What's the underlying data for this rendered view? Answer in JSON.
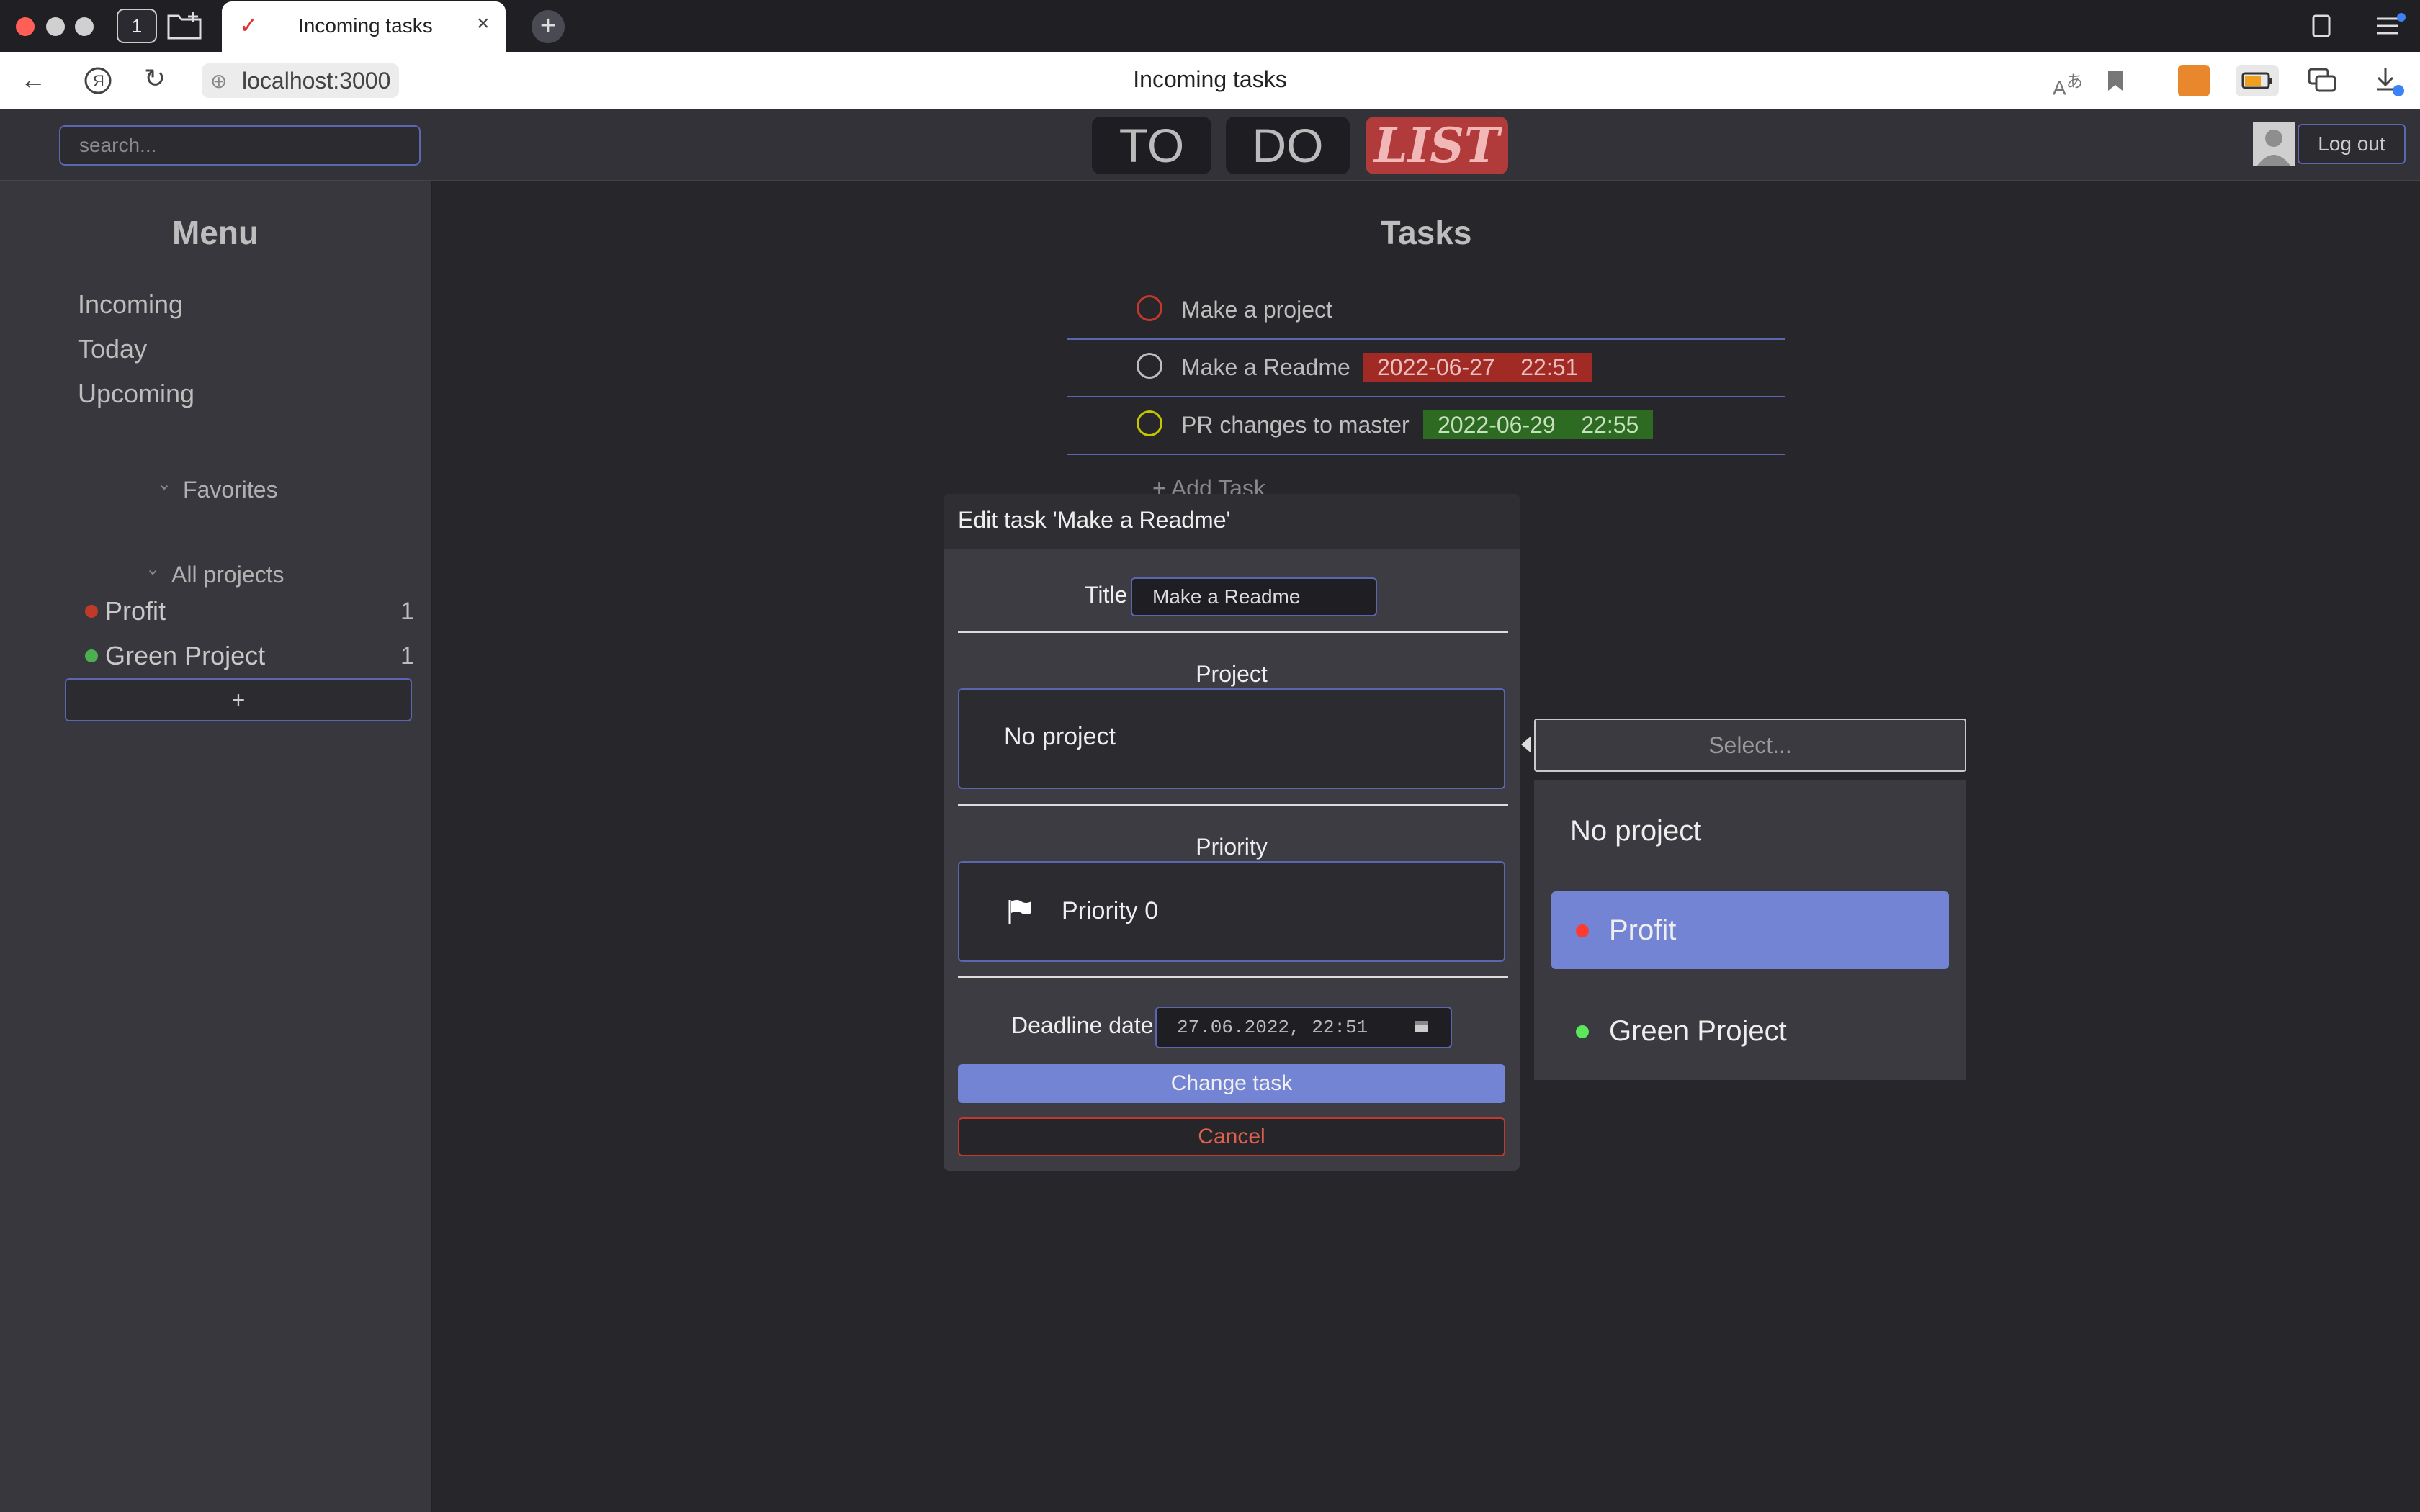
{
  "browser": {
    "tab_title": "Incoming tasks",
    "tab_close": "×",
    "tab_count": "1",
    "new_tab": "+",
    "url": "localhost:3000",
    "page_title": "Incoming tasks"
  },
  "header": {
    "search_placeholder": "search...",
    "logo": [
      "TO",
      "DO",
      "LIST"
    ],
    "logout_label": "Log out"
  },
  "sidebar": {
    "title": "Menu",
    "items": [
      {
        "label": "Incoming"
      },
      {
        "label": "Today"
      },
      {
        "label": "Upcoming"
      }
    ],
    "favorites_label": "Favorites",
    "projects_label": "All projects",
    "projects": [
      {
        "name": "Profit",
        "count": "1",
        "color": "#c0392b"
      },
      {
        "name": "Green Project",
        "count": "1",
        "color": "#4caf50"
      }
    ],
    "add_project_label": "+"
  },
  "main": {
    "title": "Tasks",
    "tasks": [
      {
        "title": "Make a project",
        "deadline": "",
        "circle_color": "#c0392b"
      },
      {
        "title": "Make a Readme",
        "deadline": "2022-06-27    22:51",
        "deadline_color": "#a12a25",
        "circle_color": "#bdbdbd"
      },
      {
        "title": "PR changes to master",
        "deadline": "2022-06-29    22:55",
        "deadline_color": "#2e6b22",
        "circle_color": "#c6c600"
      }
    ],
    "add_task_label": "+ Add Task"
  },
  "modal": {
    "title": "Edit task 'Make a Readme'",
    "title_label": "Title",
    "title_value": "Make a Readme",
    "project_label": "Project",
    "project_value": "No project",
    "priority_label": "Priority",
    "priority_value": "Priority 0",
    "deadline_label": "Deadline date",
    "deadline_value": "27.06.2022, 22:51",
    "change_label": "Change task",
    "cancel_label": "Cancel"
  },
  "dropdown": {
    "placeholder": "Select...",
    "options": [
      {
        "label": "No project",
        "color": ""
      },
      {
        "label": "Profit",
        "color": "#ff3b30",
        "selected": true
      },
      {
        "label": "Green Project",
        "color": "#5ce65c"
      }
    ]
  }
}
